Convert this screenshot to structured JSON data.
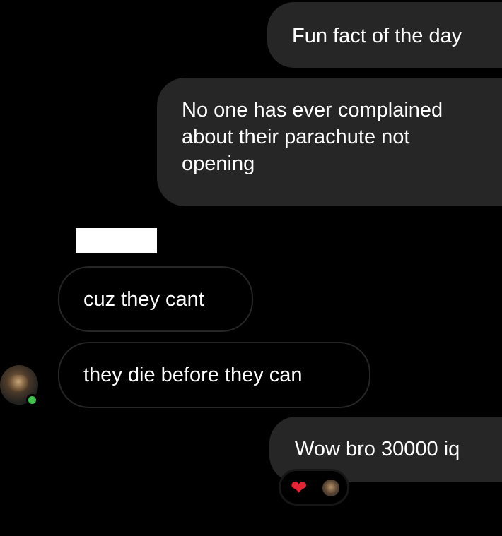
{
  "messages": {
    "sent_1": "Fun fact of the day",
    "sent_2_lines": [
      "No one has ever complained",
      "about their parachute not",
      "opening"
    ],
    "received_1": "cuz they cant",
    "received_2": "they die before they can",
    "sent_3": "Wow bro 30000 iq"
  },
  "reactions": {
    "emoji": "❤",
    "icon": "heart-icon"
  },
  "colors": {
    "background": "#000000",
    "sent_bubble": "#262626",
    "received_border": "#262626",
    "online_dot": "#3ec34d",
    "heart": "#e52332"
  }
}
